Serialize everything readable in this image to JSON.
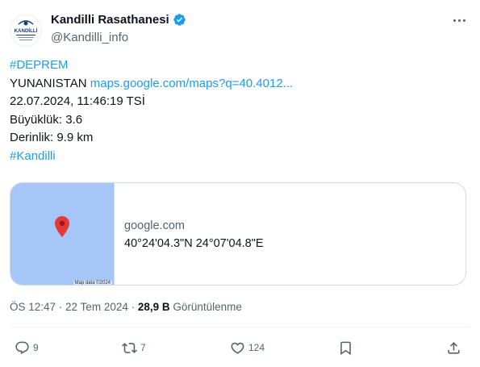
{
  "author": {
    "name": "Kandilli Rasathanesi",
    "handle": "@Kandilli_info",
    "avatar_text": "KANDİLLİ",
    "verified": true
  },
  "tweet": {
    "hashtag1": "#DEPREM",
    "location": "YUNANISTAN",
    "map_link": "maps.google.com/maps?q=40.4012...",
    "datetime": "22.07.2024, 11:46:19 TSİ",
    "magnitude": "Büyüklük: 3.6",
    "depth": "Derinlik: 9.9 km",
    "hashtag2": "#Kandilli"
  },
  "card": {
    "domain": "google.com",
    "coordinates": "40°24'04.3\"N 24°07'04.8\"E",
    "map_credit": "Map data ©2024",
    "map_color": "#a6c6f7",
    "pin_color": "#e53935"
  },
  "meta": {
    "time_date": "ÖS 12:47 · 22 Tem 2024 · ",
    "views_count": "28,9 B",
    "views_label": " Görüntülenme"
  },
  "actions": {
    "reply_count": "9",
    "retweet_count": "7",
    "like_count": "124"
  },
  "icons": [
    "verified-badge-icon",
    "more-icon",
    "map-pin-icon",
    "reply-icon",
    "retweet-icon",
    "like-icon",
    "bookmark-icon",
    "share-icon"
  ],
  "colors": {
    "link": "#1d9bf0",
    "secondary_text": "#536471",
    "primary_text": "#0f1419"
  }
}
